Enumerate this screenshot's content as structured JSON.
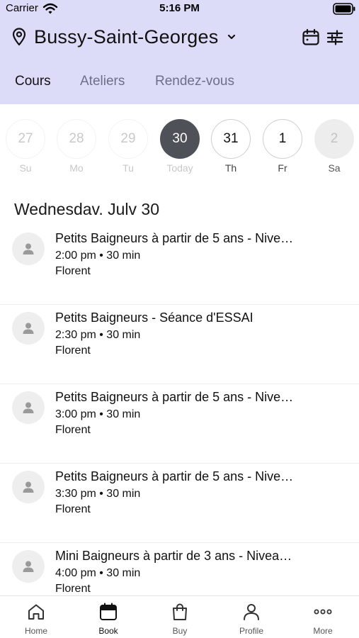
{
  "status_bar": {
    "carrier": "Carrier",
    "time": "5:16 PM"
  },
  "header": {
    "location": "Bussy-Saint-Georges",
    "icons": [
      "location-pin-icon",
      "chevron-down-icon",
      "calendar-icon",
      "filter-sliders-icon"
    ],
    "background_color": "#dcdcf8"
  },
  "tabs": [
    {
      "label": "Cours",
      "active": true
    },
    {
      "label": "Ateliers",
      "active": false
    },
    {
      "label": "Rendez-vous",
      "active": false
    }
  ],
  "week": [
    {
      "num": "27",
      "label": "Su"
    },
    {
      "num": "28",
      "label": "Mo"
    },
    {
      "num": "29",
      "label": "Tu"
    },
    {
      "num": "30",
      "label": "Today"
    },
    {
      "num": "31",
      "label": "Th"
    },
    {
      "num": "1",
      "label": "Fr"
    },
    {
      "num": "2",
      "label": "Sa"
    }
  ],
  "date_heading": "Wednesdav. Julv 30",
  "sessions": [
    {
      "title": "Petits Baigneurs à partir de 5 ans - Nive…",
      "time": "2:00 pm • 30 min",
      "instructor": "Florent"
    },
    {
      "title": "Petits Baigneurs - Séance d'ESSAI",
      "time": "2:30 pm • 30 min",
      "instructor": "Florent"
    },
    {
      "title": "Petits Baigneurs à partir de 5 ans - Nive…",
      "time": "3:00 pm • 30 min",
      "instructor": "Florent"
    },
    {
      "title": "Petits Baigneurs à partir de 5 ans - Nive…",
      "time": "3:30 pm • 30 min",
      "instructor": "Florent"
    },
    {
      "title": "Mini Baigneurs à partir de 3 ans - Nivea…",
      "time": "4:00 pm • 30 min",
      "instructor": "Florent"
    }
  ],
  "tabbar": [
    {
      "label": "Home",
      "icon": "home-icon"
    },
    {
      "label": "Book",
      "icon": "book-calendar-icon",
      "active": true
    },
    {
      "label": "Buy",
      "icon": "shopping-bag-icon"
    },
    {
      "label": "Profile",
      "icon": "profile-icon"
    },
    {
      "label": "More",
      "icon": "more-dots-icon"
    }
  ],
  "colors": {
    "today_fill": "#4f5158",
    "header_bg": "#dcdcf8",
    "inactive_tab": "#6d6f86"
  }
}
